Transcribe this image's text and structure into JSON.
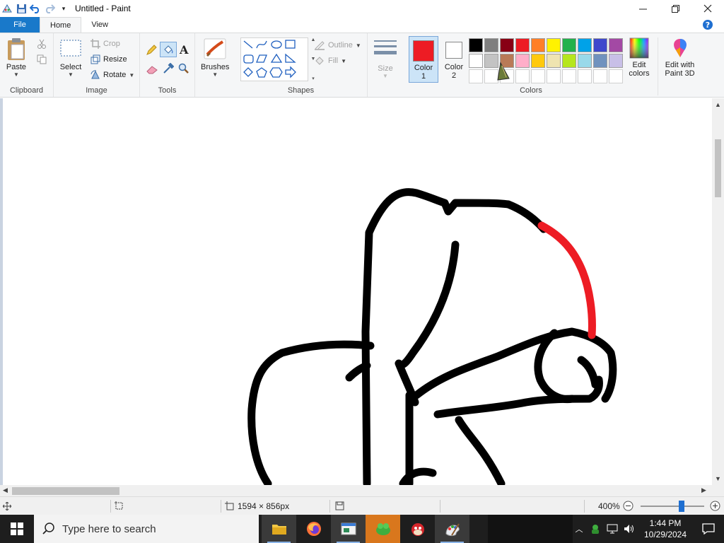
{
  "window": {
    "title": "Untitled - Paint",
    "minimize_icon": "minimize-icon",
    "maximize_icon": "restore-icon",
    "close_icon": "close-icon"
  },
  "tabs": [
    {
      "label": "File"
    },
    {
      "label": "Home"
    },
    {
      "label": "View"
    }
  ],
  "ribbon": {
    "clipboard": {
      "label": "Clipboard",
      "paste": "Paste"
    },
    "image": {
      "label": "Image",
      "select": "Select",
      "crop": "Crop",
      "resize": "Resize",
      "rotate": "Rotate"
    },
    "tools": {
      "label": "Tools"
    },
    "brushes": {
      "label": "Brushes"
    },
    "shapes": {
      "label": "Shapes",
      "outline": "Outline",
      "fill": "Fill"
    },
    "size": {
      "label": "Size"
    },
    "colors": {
      "label": "Colors",
      "color1": "Color\n1",
      "color1_a": "Color",
      "color1_b": "1",
      "color2_a": "Color",
      "color2_b": "2",
      "color1_value": "#ed1c24",
      "color2_value": "#ffffff",
      "edit_colors_a": "Edit",
      "edit_colors_b": "colors",
      "paint3d_a": "Edit with",
      "paint3d_b": "Paint 3D",
      "palette": [
        "#000000",
        "#7f7f7f",
        "#880015",
        "#ed1c24",
        "#ff7f27",
        "#fff200",
        "#22b14c",
        "#00a2e8",
        "#3f48cc",
        "#a349a4",
        "#ffffff",
        "#c3c3c3",
        "#b97a57",
        "#ffaec9",
        "#ffc90e",
        "#efe4b0",
        "#b5e61d",
        "#99d9ea",
        "#7092be",
        "#c8bfe7",
        "#ffffff",
        "#ffffff",
        "#ffffff",
        "#ffffff",
        "#ffffff",
        "#ffffff",
        "#ffffff",
        "#ffffff",
        "#ffffff",
        "#ffffff"
      ]
    }
  },
  "status": {
    "dimensions": "1594 × 856px",
    "zoom": "400%"
  },
  "taskbar": {
    "search_placeholder": "Type here to search",
    "time": "1:44 PM",
    "date": "10/29/2024"
  }
}
